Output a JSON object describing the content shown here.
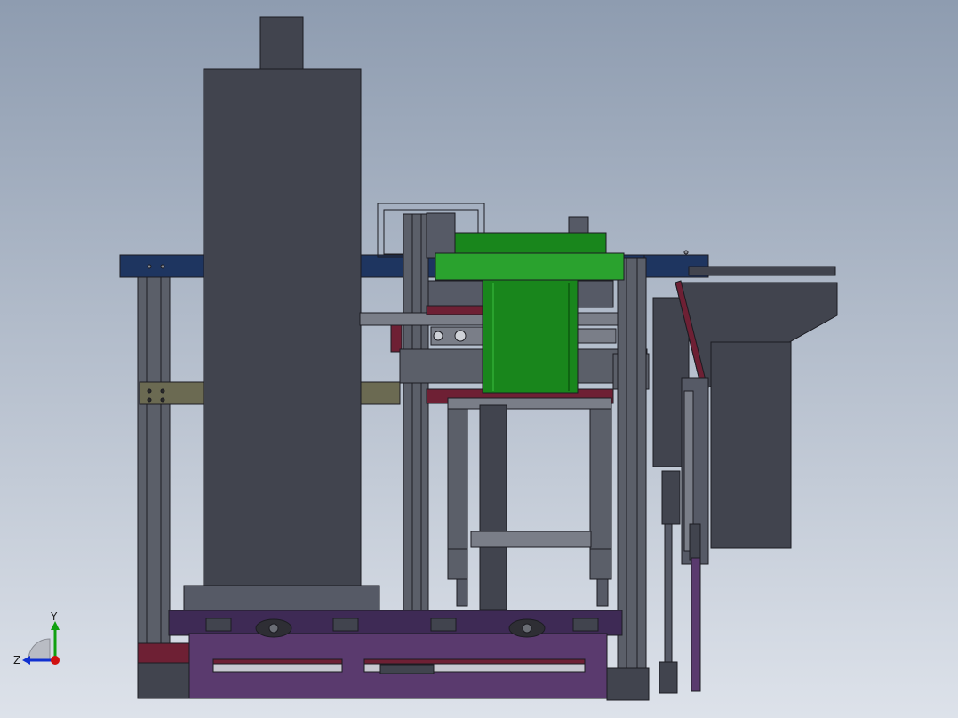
{
  "view": {
    "background_top": "#8e9cb0",
    "background_bottom": "#dde2ea"
  },
  "colors": {
    "outline": "#1c1c22",
    "housing": "#41444e",
    "housing_light": "#565a66",
    "frame": "#5b5f69",
    "frame_light": "#7a7e88",
    "rail_blue": "#1e3560",
    "green": "#19861c",
    "green_dark": "#0f6412",
    "green_light": "#2aa22e",
    "purple": "#5a3a6e",
    "purple_dark": "#3e2a55",
    "maroon": "#6e2034",
    "olive": "#6b6a52",
    "axis_x": "#d01010",
    "axis_y": "#10a010",
    "axis_z": "#1030d0"
  },
  "triad": {
    "y_label": "Y",
    "z_label": "Z"
  }
}
